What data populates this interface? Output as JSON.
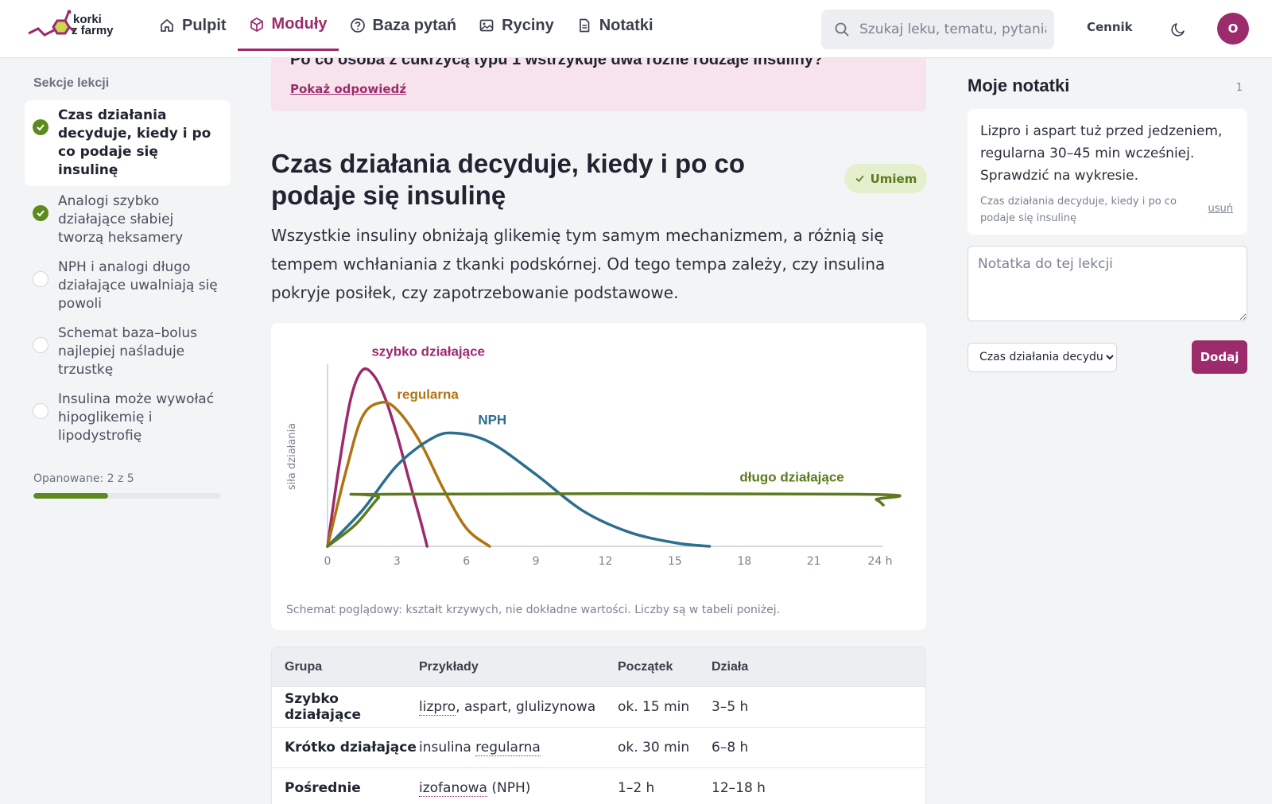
{
  "brand": {
    "line1": "korki",
    "line2": "z farmy"
  },
  "nav": [
    {
      "label": "Pulpit",
      "icon": "home-icon"
    },
    {
      "label": "Moduły",
      "icon": "cube-icon"
    },
    {
      "label": "Baza pytań",
      "icon": "question-icon"
    },
    {
      "label": "Ryciny",
      "icon": "image-icon"
    },
    {
      "label": "Notatki",
      "icon": "document-icon"
    }
  ],
  "search": {
    "placeholder": "Szukaj leku, tematu, pytania"
  },
  "pricing_label": "Cennik",
  "avatar_initial": "O",
  "sidebar": {
    "title": "Sekcje lekcji",
    "sections": [
      {
        "label": "Czas działania decyduje, kiedy i po co podaje się insulinę",
        "done": true,
        "active": true
      },
      {
        "label": "Analogi szybko działające słabiej tworzą heksamery",
        "done": true,
        "active": false
      },
      {
        "label": "NPH i analogi długo działające uwalniają się powoli",
        "done": false,
        "active": false
      },
      {
        "label": "Schemat baza–bolus najlepiej naśladuje trzustkę",
        "done": false,
        "active": false
      },
      {
        "label": "Insulina może wywołać hipoglikemię i lipodystrofię",
        "done": false,
        "active": false
      }
    ],
    "mastered": "Opanowane: 2 z 5",
    "progress_fraction": 0.4
  },
  "quiz": {
    "question": "Po co osoba z cukrzycą typu 1 wstrzykuje dwa różne rodzaje insuliny?",
    "show_answer": "Pokaż odpowiedź"
  },
  "lesson": {
    "title": "Czas działania decyduje, kiedy i po co podaje się insulinę",
    "badge": "Umiem",
    "paragraph": "Wszystkie insuliny obniżają glikemię tym samym mechanizmem, a różnią się tempem wchłaniania z tkanki podskórnej. Od tego tempa zależy, czy insulina pokryje posiłek, czy zapotrzebowanie podstawowe.",
    "chart_caption": "Schemat poglądowy: kształt krzywych, nie dokładne wartości. Liczby są w tabeli poniżej."
  },
  "chart_data": {
    "type": "line",
    "ylabel": "siła działania",
    "x_ticks": [
      "0",
      "3",
      "6",
      "9",
      "12",
      "15",
      "18",
      "21",
      "24 h"
    ],
    "xlim": [
      0,
      24
    ],
    "grid": false,
    "series": [
      {
        "name": "szybko działające",
        "color": "#9c2b6c",
        "points": [
          [
            0,
            0
          ],
          [
            0.5,
            0.45
          ],
          [
            1,
            0.82
          ],
          [
            1.5,
            0.98
          ],
          [
            2,
            0.95
          ],
          [
            2.5,
            0.82
          ],
          [
            3,
            0.62
          ],
          [
            3.5,
            0.38
          ],
          [
            4,
            0.15
          ],
          [
            4.3,
            0
          ]
        ]
      },
      {
        "name": "regularna",
        "color": "#b0730f",
        "points": [
          [
            0,
            0
          ],
          [
            0.8,
            0.42
          ],
          [
            1.5,
            0.72
          ],
          [
            2.3,
            0.8
          ],
          [
            3,
            0.76
          ],
          [
            4,
            0.58
          ],
          [
            5,
            0.32
          ],
          [
            6,
            0.1
          ],
          [
            7,
            0
          ]
        ]
      },
      {
        "name": "NPH",
        "color": "#2b6e8f",
        "points": [
          [
            0,
            0
          ],
          [
            1.5,
            0.2
          ],
          [
            3,
            0.45
          ],
          [
            4.5,
            0.6
          ],
          [
            5.5,
            0.63
          ],
          [
            7,
            0.58
          ],
          [
            9,
            0.4
          ],
          [
            11,
            0.2
          ],
          [
            13,
            0.08
          ],
          [
            15,
            0.02
          ],
          [
            16.5,
            0
          ]
        ]
      },
      {
        "name": "długo działające",
        "color": "#5d7a1e",
        "points": [
          [
            0,
            0
          ],
          [
            1.2,
            0.12
          ],
          [
            2.2,
            0.27
          ],
          [
            2.6,
            0.29
          ],
          [
            23,
            0.29
          ],
          [
            23.7,
            0.26
          ],
          [
            24,
            0.23
          ]
        ]
      }
    ]
  },
  "table": {
    "headers": [
      "Grupa",
      "Przykłady",
      "Początek",
      "Działa"
    ],
    "rows": [
      {
        "group": "Szybko działające",
        "examples_term": "lizpro",
        "examples_rest": ", aspart, glulizynowa",
        "start": "ok. 15 min",
        "duration": "3–5 h"
      },
      {
        "group": "Krótko działające",
        "examples_prefix": "insulina ",
        "examples_term": "regularna",
        "start": "ok. 30 min",
        "duration": "6–8 h"
      },
      {
        "group": "Pośrednie",
        "examples_term": "izofanowa",
        "examples_rest": " (NPH)",
        "start": "1–2 h",
        "duration": "12–18 h"
      }
    ]
  },
  "notes": {
    "title": "Moje notatki",
    "count": "1",
    "card_text": "Lizpro i aspart tuż przed jedzeniem, regularna 30–45 min wcześniej. Sprawdzić na wykresie.",
    "card_ref": "Czas działania decyduje, kiedy i po co podaje się insulinę",
    "delete_label": "usuń",
    "input_placeholder": "Notatka do tej lekcji",
    "select_value": "Czas działania decydu",
    "add_label": "Dodaj"
  },
  "colors": {
    "accent": "#9c2b6c",
    "success": "#5d8a1e",
    "success_bg": "#e4efcd",
    "quiz_bg": "#f6e3ec"
  }
}
